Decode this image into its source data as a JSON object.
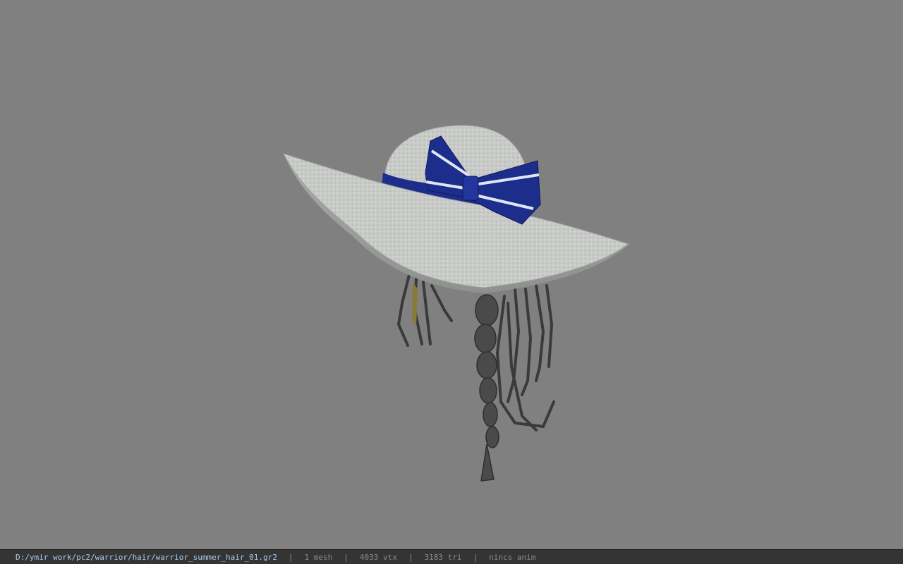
{
  "viewport": {
    "background_color": "#808080",
    "model": {
      "icon": "3d-model-icon",
      "hat_color": "#c9ccc9",
      "ribbon_color": "#1c2d8c",
      "stripe_color": "#dfe6f5",
      "hair_color": "#3a3a3a"
    }
  },
  "statusbar": {
    "file_path": "D:/ymir work/pc2/warrior/hair/warrior_summer_hair_01.gr2",
    "separator": "|",
    "mesh_count": "1 mesh",
    "vertex_count": "4033 vtx",
    "triangle_count": "3183 tri",
    "animation": "nincs anim"
  }
}
